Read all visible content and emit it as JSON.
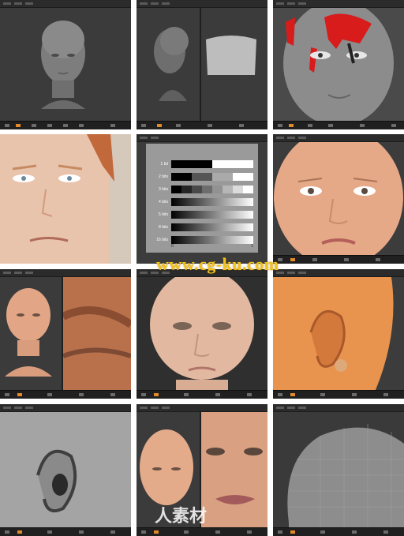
{
  "watermark": {
    "site": "www.cg-ku.com",
    "brand": "人素材"
  },
  "gradient_panel": {
    "rows": [
      "1 bit",
      "2 bits",
      "3 bits",
      "4 bits",
      "5 bits",
      "8 bits",
      "16 bits"
    ],
    "axis_min": "0",
    "axis_max": "1"
  },
  "colors": {
    "app_bg": "#3a3a3a",
    "toolbar_bg": "#202020",
    "accent": "#e08a2a",
    "watermark": "#f2c21a",
    "skin": "#e6a987",
    "mask_red": "#d81b1b"
  }
}
